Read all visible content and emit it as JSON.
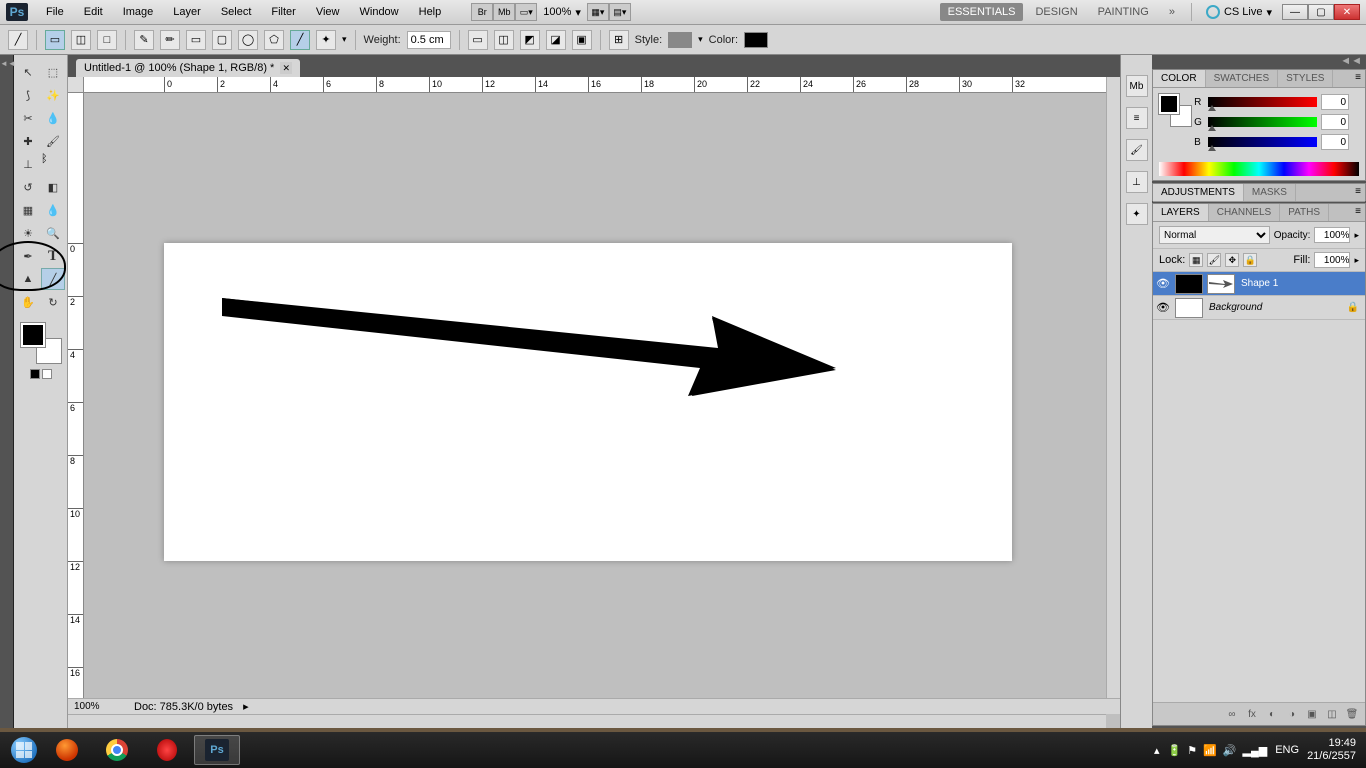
{
  "menubar": {
    "items": [
      "File",
      "Edit",
      "Image",
      "Layer",
      "Select",
      "Filter",
      "View",
      "Window",
      "Help"
    ],
    "zoom": "100%",
    "workspaces": [
      "ESSENTIALS",
      "DESIGN",
      "PAINTING"
    ],
    "more": "»",
    "cslive": "CS Live"
  },
  "options": {
    "weight_label": "Weight:",
    "weight_value": "0.5 cm",
    "style_label": "Style:",
    "color_label": "Color:"
  },
  "document": {
    "tab_title": "Untitled-1 @ 100% (Shape 1, RGB/8) *",
    "status_zoom": "100%",
    "status_doc": "Doc: 785.3K/0 bytes",
    "ruler_h": [
      "0",
      "2",
      "4",
      "6",
      "8",
      "10",
      "12",
      "14",
      "16",
      "18",
      "20",
      "22",
      "24",
      "26",
      "28",
      "30",
      "32"
    ],
    "ruler_v": [
      "0",
      "2",
      "4",
      "6",
      "8",
      "10",
      "12",
      "14",
      "16"
    ]
  },
  "panels": {
    "color": {
      "tabs": [
        "COLOR",
        "SWATCHES",
        "STYLES"
      ],
      "r_label": "R",
      "g_label": "G",
      "b_label": "B",
      "r_value": "0",
      "g_value": "0",
      "b_value": "0"
    },
    "adjustments": {
      "tabs": [
        "ADJUSTMENTS",
        "MASKS"
      ]
    },
    "layers": {
      "tabs": [
        "LAYERS",
        "CHANNELS",
        "PATHS"
      ],
      "blend_mode": "Normal",
      "opacity_label": "Opacity:",
      "opacity_value": "100%",
      "lock_label": "Lock:",
      "fill_label": "Fill:",
      "fill_value": "100%",
      "items": [
        {
          "name": "Shape 1",
          "selected": true,
          "locked": false
        },
        {
          "name": "Background",
          "selected": false,
          "locked": true
        }
      ]
    }
  },
  "taskbar": {
    "lang": "ENG",
    "time": "19:49",
    "date": "21/6/2557"
  }
}
